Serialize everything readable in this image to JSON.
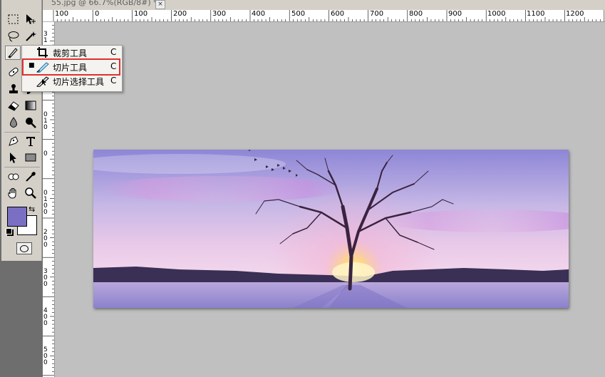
{
  "document": {
    "tab_title": "55.jpg @ 66.7%(RGB/8#) *",
    "close_glyph": "×"
  },
  "ruler": {
    "horizontal": [
      "100",
      "0",
      "100",
      "200",
      "300",
      "400",
      "500",
      "600",
      "700",
      "800",
      "900",
      "1000",
      "1100",
      "1200"
    ],
    "vertical": [
      "3",
      "1",
      "0",
      "1",
      "0",
      "0",
      "0",
      "1",
      "0",
      "0",
      "2",
      "0",
      "0",
      "3",
      "0",
      "0",
      "4",
      "0",
      "0",
      "5",
      "0",
      "0"
    ]
  },
  "toolbox": {
    "tools": [
      "marquee-icon",
      "move-icon",
      "lasso-icon",
      "magic-wand-icon",
      "slice-icon",
      "healing-icon",
      "brush-icon",
      "stamp-icon",
      "history-brush-icon",
      "eraser-icon",
      "gradient-icon",
      "blur-icon",
      "dodge-icon",
      "pen-icon",
      "type-icon",
      "path-select-icon",
      "shape-icon",
      "notes-icon",
      "eyedropper-icon",
      "hand-icon",
      "zoom-icon"
    ],
    "foreground_color": "#7b6fc4",
    "background_color": "#ffffff"
  },
  "flyout": {
    "items": [
      {
        "label": "裁剪工具",
        "shortcut": "C",
        "selected": false
      },
      {
        "label": "切片工具",
        "shortcut": "C",
        "selected": true
      },
      {
        "label": "切片选择工具",
        "shortcut": "C",
        "selected": false
      }
    ],
    "selected_mark": "■"
  },
  "colors": {
    "highlight": "#e03030",
    "accent": "#7b6fc4"
  }
}
